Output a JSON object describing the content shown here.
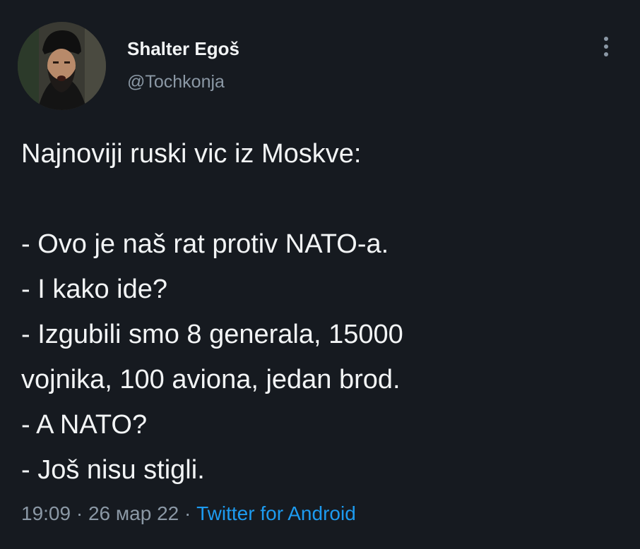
{
  "author": {
    "display_name": "Shalter Egoš",
    "handle": "@Tochkonja",
    "avatar_icon": "profile-photo"
  },
  "tweet": {
    "lines": [
      "Najnoviji ruski vic iz Moskve:",
      "",
      "- Ovo je naš rat protiv NATO-a.",
      "- I kako ide?",
      "- Izgubili smo 8 generala, 15000",
      "vojnika, 100 aviona, jedan brod.",
      "- A NATO?",
      "- Još nisu stigli."
    ]
  },
  "meta": {
    "time": "19:09",
    "separator": "·",
    "date": "26 мар 22",
    "source": "Twitter for Android"
  },
  "colors": {
    "background": "#161a20",
    "text": "#f2f4f5",
    "secondary": "#8b98a5",
    "link": "#1d9bf0"
  },
  "menu_icon": "more-vertical-icon"
}
